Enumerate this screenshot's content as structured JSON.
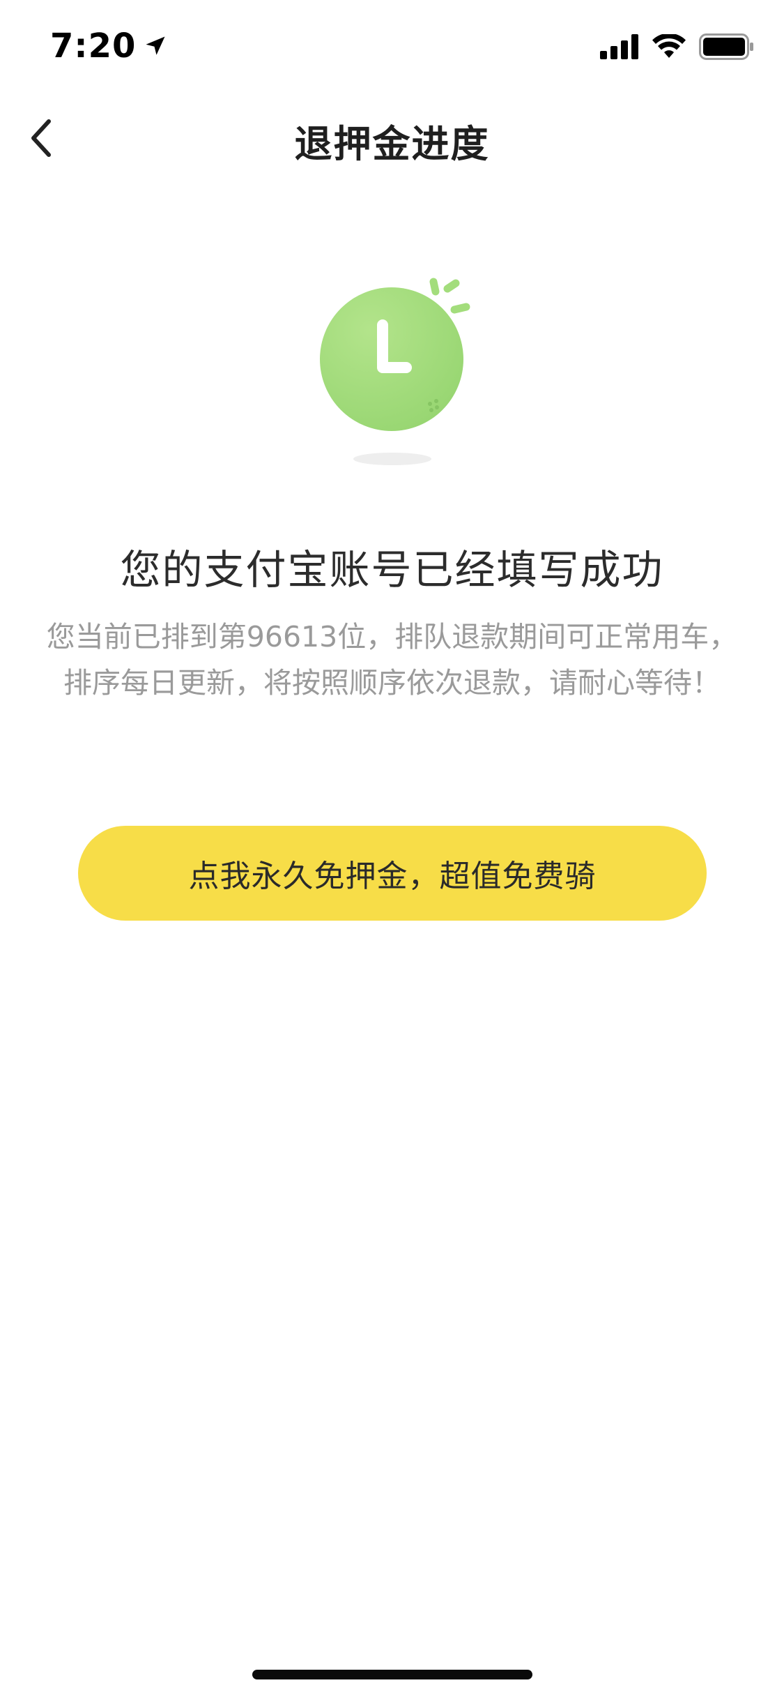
{
  "status_bar": {
    "time": "7:20",
    "location_icon": "location-arrow-icon",
    "signal_icon": "cellular-signal-icon",
    "wifi_icon": "wifi-icon",
    "battery_icon": "battery-icon"
  },
  "nav": {
    "title": "退押金进度",
    "back_icon": "chevron-left-icon"
  },
  "illustration": {
    "icon": "clock-icon",
    "color": "#a3dd7c"
  },
  "main": {
    "headline": "您的支付宝账号已经填写成功",
    "description_line1": "您当前已排到第96613位，排队退款期间可正常用车，",
    "description_line2": "排序每日更新，将按照顺序依次退款，请耐心等待！"
  },
  "cta": {
    "label": "点我永久免押金，超值免费骑",
    "color": "#f7dd48"
  }
}
